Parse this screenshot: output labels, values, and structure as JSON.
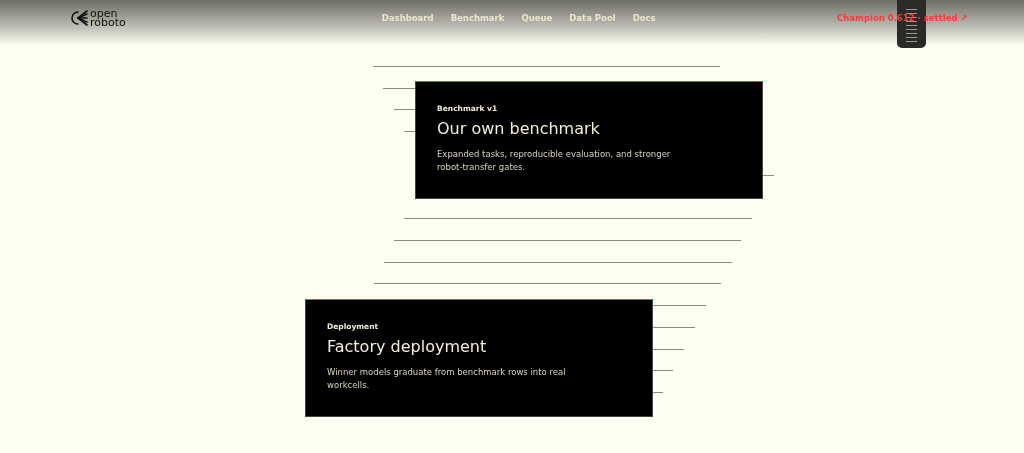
{
  "header": {
    "logo": {
      "line_1": "open",
      "line_2": "roboto"
    },
    "nav": [
      {
        "label": "Dashboard"
      },
      {
        "label": "Benchmark"
      },
      {
        "label": "Queue"
      },
      {
        "label": "Data Pool"
      },
      {
        "label": "Docs"
      }
    ],
    "status_link": {
      "label": "Champion 0.612 · settled",
      "icon": "↗"
    }
  },
  "cards": [
    {
      "eyebrow": "Benchmark v1",
      "title": "Our own benchmark",
      "text": "Expanded tasks, reproducible evaluation, and stronger robot-transfer gates."
    },
    {
      "eyebrow": "Deployment",
      "title": "Factory deployment",
      "text": "Winner models graduate from benchmark rows into real workcells."
    }
  ]
}
